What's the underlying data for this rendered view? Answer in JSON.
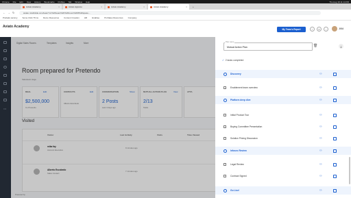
{
  "menubar": {
    "items": [
      "Chrome",
      "File",
      "Edit",
      "View",
      "History",
      "Bookmarks",
      "Profiles",
      "Tab",
      "Window",
      "Help"
    ],
    "clock": "Thu Aug 18 11:14 PM"
  },
  "tabs": [
    "Aviato Academy",
    "Aviato Appsmo",
    "Aviato Academy",
    "Aviato Academy"
  ],
  "url": "aviato.mindtickle.com/team?u=%2Fteam%2F%20room%2F8%20space...",
  "bookmarks": [
    "Prebaks sammy",
    "Some Click Thms",
    "Demo Resources",
    "Content Creation",
    "HR",
    "Enablee",
    "ProSales Resources",
    "Company"
  ],
  "header": {
    "brand": "Aviato Academy",
    "report_button": "My Team's Report",
    "avatar_label": "Jill64"
  },
  "backdrop": {
    "pills": [
      "Digital Sales Rooms",
      "Templates",
      "Insights",
      "More"
    ],
    "title": "Room prepared for Pretendo",
    "subtitle": "Salesteam stage",
    "cards": [
      {
        "label": "DEAL",
        "link": "Edit",
        "value": "$2,500,000",
        "small": "Co Pretendo"
      },
      {
        "label": "CONTACTS",
        "link": "Edit",
        "value": "Alberto Escobedo",
        "small": ""
      },
      {
        "label": "CONVERSATION",
        "link": "Show",
        "value": "2 Posts",
        "small": "Last 3 days ago"
      },
      {
        "label": "MUTUAL ACTION PLAN",
        "link": "View",
        "value": "2/13",
        "small": "Tasks"
      },
      {
        "label": "ATTA",
        "link": "",
        "value": "",
        "small": ""
      }
    ],
    "visited_heading": "Visited",
    "visit_headers": [
      "Visitor",
      "Last Activity",
      "Visits",
      "Time Viewed"
    ],
    "visits": [
      {
        "name": "mika fay",
        "role": "Account Executive",
        "activity": "9 minutes ago"
      },
      {
        "name": "Alberto Escobedo",
        "role": "Sales Contact",
        "activity": "7 minutes ago"
      }
    ],
    "powered": "Powered by"
  },
  "panel": {
    "name_label": "Plan name",
    "name_value": "Mutual Action Plan",
    "completed": "2 tasks completed",
    "rows": [
      {
        "kind": "stage",
        "text": "Discovery"
      },
      {
        "kind": "task",
        "text": "Enablement team overview"
      },
      {
        "kind": "stage",
        "text": "Platform deep dive"
      },
      {
        "kind": "task",
        "text": "Initial Product Tour"
      },
      {
        "kind": "task",
        "text": "Buying Committee Presentation"
      },
      {
        "kind": "task",
        "text": "Solution Pricing Discussion"
      },
      {
        "kind": "stage",
        "text": "Infosec Review"
      },
      {
        "kind": "task",
        "text": "Legal Review"
      },
      {
        "kind": "task",
        "text": "Contract Signed"
      },
      {
        "kind": "stage",
        "text": "Go Live!"
      }
    ]
  }
}
